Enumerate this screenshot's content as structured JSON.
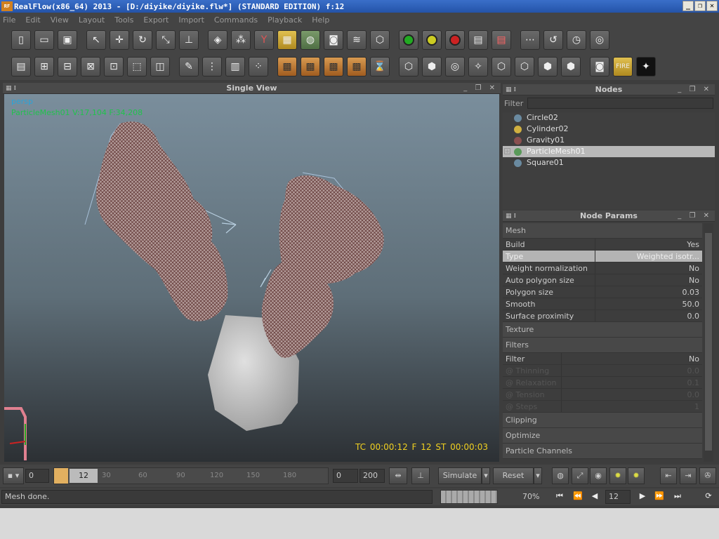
{
  "window": {
    "title": "RealFlow(x86_64) 2013 - [D:/diyike/diyike.flw*] (STANDARD EDITION) f:12",
    "logo": "RF",
    "buttons": [
      "_",
      "❐",
      "✕"
    ]
  },
  "menu": [
    "File",
    "Edit",
    "View",
    "Layout",
    "Tools",
    "Export",
    "Import",
    "Commands",
    "Playback",
    "Help"
  ],
  "viewport": {
    "title": "Single View",
    "camera": "persp",
    "selection": "ParticleMesh01 V:17,104 F:34,208",
    "timecode": "TC 00:00:12   F 12   ST 00:00:03"
  },
  "nodes_panel": {
    "title": "Nodes",
    "filter_label": "Filter",
    "items": [
      {
        "label": "Circle02",
        "icon": "emitter-icon",
        "color": "#6a8aa0"
      },
      {
        "label": "Cylinder02",
        "icon": "object-icon",
        "color": "#d0b040"
      },
      {
        "label": "Gravity01",
        "icon": "daemon-icon",
        "color": "#8a5050"
      },
      {
        "label": "ParticleMesh01",
        "icon": "mesh-icon",
        "color": "#5a9a5a"
      },
      {
        "label": "Square01",
        "icon": "emitter-icon",
        "color": "#6a8aa0"
      }
    ]
  },
  "params_panel": {
    "title": "Node Params",
    "mesh_section": "Mesh",
    "mesh_rows": [
      {
        "key": "Build",
        "value": "Yes"
      },
      {
        "key": "Type",
        "value": "Weighted isotr..."
      },
      {
        "key": "Weight normalization",
        "value": "No"
      },
      {
        "key": "Auto polygon size",
        "value": "No"
      },
      {
        "key": "Polygon size",
        "value": "0.03"
      },
      {
        "key": "Smooth",
        "value": "50.0"
      },
      {
        "key": "Surface proximity",
        "value": "0.0"
      }
    ],
    "texture_section": "Texture",
    "filters_section": "Filters",
    "filter_rows": [
      {
        "key": "Filter",
        "value": "No"
      },
      {
        "key": "@ Thinning",
        "value": "0.0"
      },
      {
        "key": "@ Relaxation",
        "value": "0.1"
      },
      {
        "key": "@ Tension",
        "value": "0.0"
      },
      {
        "key": "@ Steps",
        "value": "1"
      }
    ],
    "clipping_section": "Clipping",
    "optimize_section": "Optimize",
    "channels_section": "Particle Channels"
  },
  "timeline": {
    "start": "0",
    "current": "12",
    "range_start": "0",
    "range_end": "200",
    "ticks": [
      "30",
      "60",
      "90",
      "120",
      "150",
      "180"
    ],
    "simulate": "Simulate",
    "reset": "Reset"
  },
  "status": {
    "text": "Mesh done.",
    "progress_pct": "70%",
    "progress_fraction": 0.7,
    "frame": "12"
  }
}
